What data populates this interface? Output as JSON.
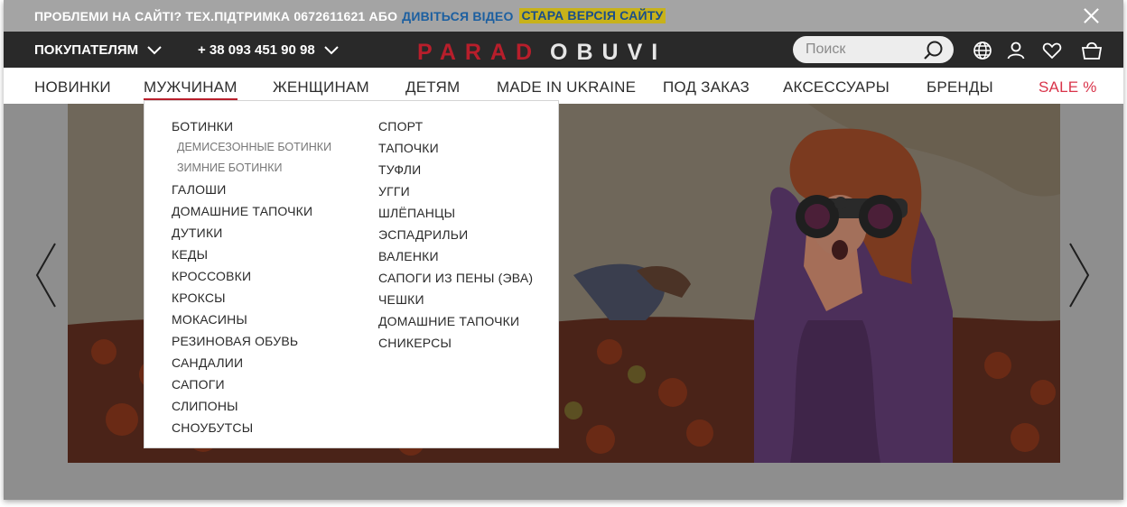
{
  "infobar": {
    "text": "ПРОБЛЕМИ НА САЙТІ? ТЕХ.ПІДТРИМКА 0672611621 АБО",
    "video_link": "ДИВІТЬСЯ ВІДЕО",
    "old_version_link": "СТАРА ВЕРСІЯ САЙТУ",
    "colors": {
      "bar": "#a4a4a4",
      "video": "#1c5fa0",
      "old_bg": "#c8b21a"
    }
  },
  "header": {
    "buyers_label": "ПОКУПАТЕЛЯМ",
    "phone": "+ 38 093 451 90 98",
    "logo": {
      "part1": "PARAD",
      "part2": "OBUVI"
    },
    "search": {
      "placeholder": "Поиск"
    },
    "icons": [
      "search-icon",
      "globe-icon",
      "user-icon",
      "heart-icon",
      "basket-icon"
    ],
    "colors": {
      "bar": "#292929",
      "accent": "#b81e2b"
    }
  },
  "nav": {
    "items": [
      "НОВИНКИ",
      "МУЖЧИНАМ",
      "ЖЕНЩИНАМ",
      "ДЕТЯМ",
      "MADE IN UKRAINE",
      "ПОД ЗАКАЗ",
      "АКСЕССУАРЫ",
      "БРЕНДЫ",
      "SALE %"
    ],
    "active": "МУЖЧИНАМ"
  },
  "dropdown": {
    "col1": {
      "boots": "БОТИНКИ",
      "boots_demi": "ДЕМИСЕЗОННЫЕ БОТИНКИ",
      "boots_winter": "ЗИМНИЕ БОТИНКИ",
      "items": [
        "ГАЛОШИ",
        "ДОМАШНИЕ ТАПОЧКИ",
        "ДУТИКИ",
        "КЕДЫ",
        "КРОССОВКИ",
        "КРОКСЫ",
        "МОКАСИНЫ",
        "РЕЗИНОВАЯ ОБУВЬ",
        "САНДАЛИИ",
        "САПОГИ",
        "СЛИПОНЫ",
        "СНОУБУТСЫ"
      ]
    },
    "col2": {
      "items": [
        "СПОРТ",
        "ТАПОЧКИ",
        "ТУФЛИ",
        "УГГИ",
        "ШЛЁПАНЦЫ",
        "ЭСПАДРИЛЬИ",
        "ВАЛЕНКИ",
        "САПОГИ ИЗ ПЕНЫ (ЭВА)",
        "ЧЕШКИ",
        "ДОМАШНИЕ ТАПОЧКИ",
        "СНИКЕРСЫ"
      ]
    }
  },
  "slider": {
    "icons": [
      "chevron-left-icon",
      "chevron-right-icon"
    ]
  }
}
